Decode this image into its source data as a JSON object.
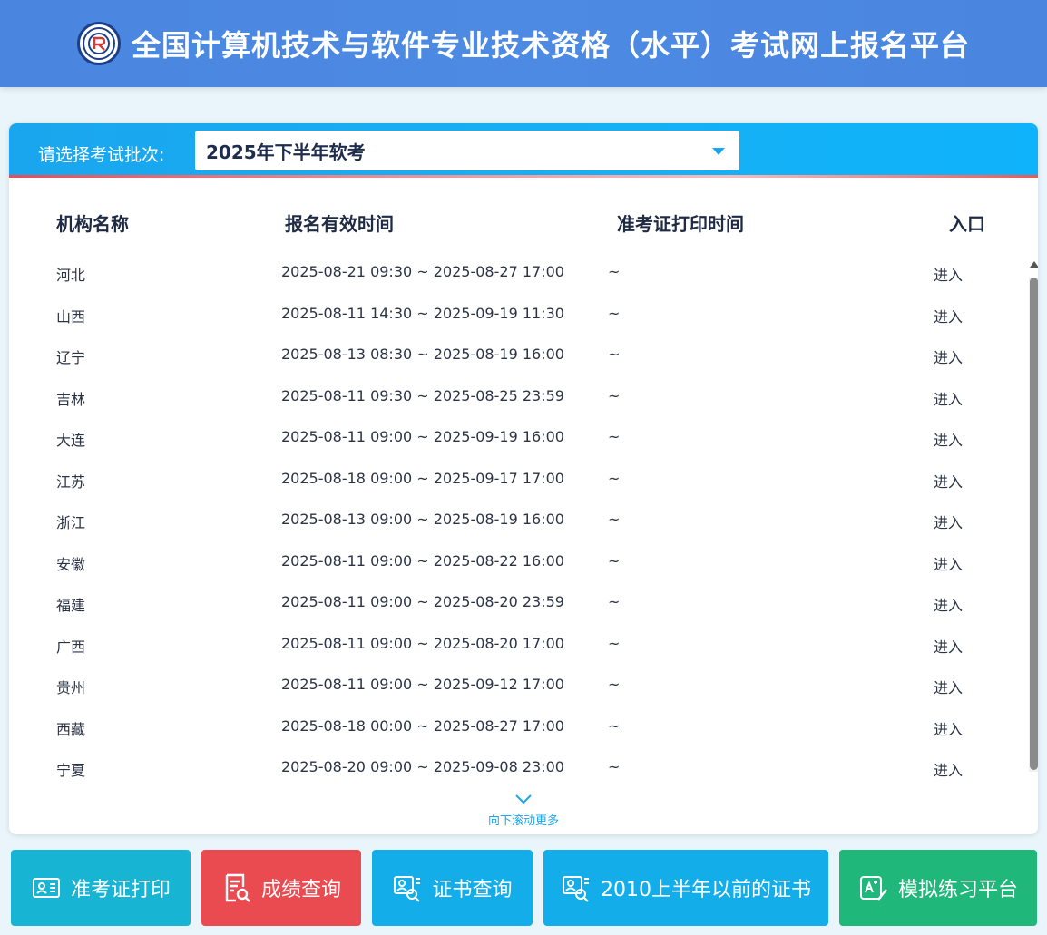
{
  "header": {
    "title": "全国计算机技术与软件专业技术资格（水平）考试网上报名平台",
    "logo_icon": "emblem-logo-icon"
  },
  "batch": {
    "label": "请选择考试批次:",
    "selected": "2025年下半年软考"
  },
  "table": {
    "headers": [
      "机构名称",
      "报名有效时间",
      "准考证打印时间",
      "入口"
    ],
    "rows": [
      {
        "org": "河北",
        "time": "2025-08-21 09:30 ~ 2025-08-27 17:00",
        "print": "~",
        "entry": "进入"
      },
      {
        "org": "山西",
        "time": "2025-08-11 14:30 ~ 2025-09-19 11:30",
        "print": "~",
        "entry": "进入"
      },
      {
        "org": "辽宁",
        "time": "2025-08-13 08:30 ~ 2025-08-19 16:00",
        "print": "~",
        "entry": "进入"
      },
      {
        "org": "吉林",
        "time": "2025-08-11 09:30 ~ 2025-08-25 23:59",
        "print": "~",
        "entry": "进入"
      },
      {
        "org": "大连",
        "time": "2025-08-11 09:00 ~ 2025-09-19 16:00",
        "print": "~",
        "entry": "进入"
      },
      {
        "org": "江苏",
        "time": "2025-08-18 09:00 ~ 2025-09-17 17:00",
        "print": "~",
        "entry": "进入"
      },
      {
        "org": "浙江",
        "time": "2025-08-13 09:00 ~ 2025-08-19 16:00",
        "print": "~",
        "entry": "进入"
      },
      {
        "org": "安徽",
        "time": "2025-08-11 09:00 ~ 2025-08-22 16:00",
        "print": "~",
        "entry": "进入"
      },
      {
        "org": "福建",
        "time": "2025-08-11 09:00 ~ 2025-08-20 23:59",
        "print": "~",
        "entry": "进入"
      },
      {
        "org": "广西",
        "time": "2025-08-11 09:00 ~ 2025-08-20 17:00",
        "print": "~",
        "entry": "进入"
      },
      {
        "org": "贵州",
        "time": "2025-08-11 09:00 ~ 2025-09-12 17:00",
        "print": "~",
        "entry": "进入"
      },
      {
        "org": "西藏",
        "time": "2025-08-18 00:00 ~ 2025-08-27 17:00",
        "print": "~",
        "entry": "进入"
      },
      {
        "org": "宁夏",
        "time": "2025-08-20 09:00 ~ 2025-09-08 23:00",
        "print": "~",
        "entry": "进入"
      }
    ]
  },
  "scroll_hint": "向下滚动更多",
  "buttons": [
    {
      "label": "准考证打印",
      "icon": "id-card-icon",
      "color": "#17b5d3"
    },
    {
      "label": "成绩查询",
      "icon": "document-search-icon",
      "color": "#ea4b50"
    },
    {
      "label": "证书查询",
      "icon": "certificate-search-icon",
      "color": "#13aee9"
    },
    {
      "label": "2010上半年以前的证书",
      "icon": "certificate-search-icon",
      "color": "#13aee9"
    },
    {
      "label": "模拟练习平台",
      "icon": "practice-edit-icon",
      "color": "#1fb77a"
    }
  ],
  "colors": {
    "header_bg": "#4a86e0",
    "panel_bar": "#16b0f4",
    "accent_red": "#e85a5a",
    "link_blue": "#1aa6ee"
  }
}
